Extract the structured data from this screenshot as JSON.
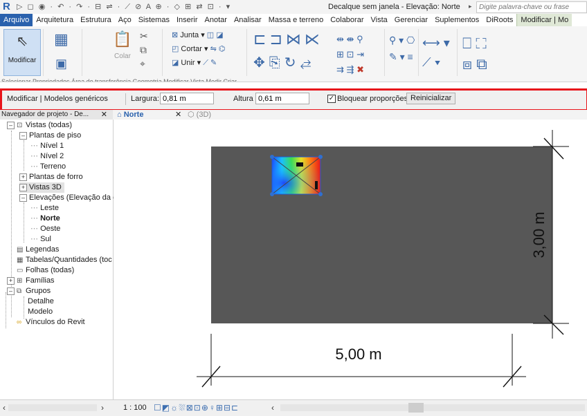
{
  "title_bar": {
    "app_logo": "R",
    "quick_access": "▷ ◻ ◉ · ↶ · ↷ · ⊟ ⇌ · ⟋ ⊘ A ⊕ · ◇ ⊞ ⇄ ⊡ · ▾",
    "window_title": "Decalque sem janela - Elevação: Norte",
    "search_placeholder": "Digite palavra-chave ou frase"
  },
  "ribbon_tabs": [
    {
      "label": "Arquivo"
    },
    {
      "label": "Arquitetura"
    },
    {
      "label": "Estrutura"
    },
    {
      "label": "Aço"
    },
    {
      "label": "Sistemas"
    },
    {
      "label": "Inserir"
    },
    {
      "label": "Anotar"
    },
    {
      "label": "Analisar"
    },
    {
      "label": "Massa e terreno"
    },
    {
      "label": "Colaborar"
    },
    {
      "label": "Vista"
    },
    {
      "label": "Gerenciar"
    },
    {
      "label": "Suplementos"
    },
    {
      "label": "DiRoots"
    },
    {
      "label": "Modificar | Mo"
    }
  ],
  "ribbon": {
    "modify_label": "Modificar",
    "paste_label": "Colar",
    "join_label": "Junta",
    "cut_label": "Cortar",
    "union_label": "Unir",
    "panel_labels": "Selecionar   Propriedades   Área de transferência      Geometria                    Modificar                   Vista      Medir      Criar"
  },
  "options_bar": {
    "context_label": "Modificar | Modelos genéricos",
    "width_label": "Largura:",
    "width_value": "0,81 m",
    "height_label": "Altura",
    "height_value": "0,61 m",
    "lock_label": "Bloquear proporções",
    "lock_checked": "✓",
    "reset_button": "Reinicializar"
  },
  "project_browser": {
    "header": "Navegador de projeto - De...",
    "close": "✕",
    "items": [
      {
        "label": "Vistas (todas)"
      },
      {
        "label": "Plantas de piso"
      },
      {
        "label": "Nível 1"
      },
      {
        "label": "Nível 2"
      },
      {
        "label": "Terreno"
      },
      {
        "label": "Plantas de forro"
      },
      {
        "label": "Vistas 3D"
      },
      {
        "label": "Elevações (Elevação da c"
      },
      {
        "label": "Leste"
      },
      {
        "label": "Norte"
      },
      {
        "label": "Oeste"
      },
      {
        "label": "Sul"
      },
      {
        "label": "Legendas"
      },
      {
        "label": "Tabelas/Quantidades (toc"
      },
      {
        "label": "Folhas (todas)"
      },
      {
        "label": "Famílias"
      },
      {
        "label": "Grupos"
      },
      {
        "label": "Detalhe"
      },
      {
        "label": "Modelo"
      },
      {
        "label": "Vínculos do Revit"
      }
    ]
  },
  "view_tabs": [
    {
      "label": "Norte",
      "close": "✕"
    },
    {
      "label": "(3D)"
    }
  ],
  "drawing": {
    "dim_width": "5,00 m",
    "dim_height": "3,00 m",
    "wall_color": "#575757",
    "decal_grip_color": "#2f6fd1"
  },
  "status_bar": {
    "scale": "1 : 100"
  }
}
